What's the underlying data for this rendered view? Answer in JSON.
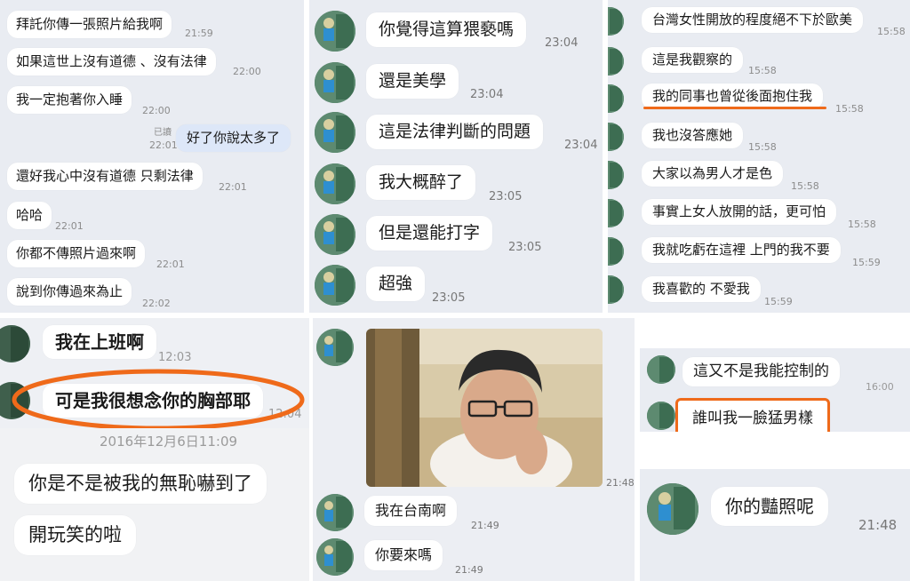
{
  "panel1": {
    "messages": [
      {
        "text": "拜託你傳一張照片給我啊",
        "time": "21:59"
      },
      {
        "text": "如果這世上沒有道德 、沒有法律",
        "time": "22:00"
      },
      {
        "text": "我一定抱著你入睡",
        "time": "22:00"
      },
      {
        "text": "好了你說太多了",
        "time": "22:01",
        "read": "已讀"
      },
      {
        "text": "還好我心中沒有道德 只剩法律",
        "time": "22:01"
      },
      {
        "text": "哈哈",
        "time": "22:01"
      },
      {
        "text": "你都不傳照片過來啊",
        "time": "22:01"
      },
      {
        "text": "說到你傳過來為止",
        "time": "22:02"
      }
    ]
  },
  "panel2": {
    "messages": [
      {
        "text": "你覺得這算猥褻嗎",
        "time": "23:04"
      },
      {
        "text": "還是美學",
        "time": "23:04"
      },
      {
        "text": "這是法律判斷的問題",
        "time": "23:04"
      },
      {
        "text": "我大概醉了",
        "time": "23:05"
      },
      {
        "text": "但是還能打字",
        "time": "23:05"
      },
      {
        "text": "超強",
        "time": "23:05"
      }
    ]
  },
  "panel3": {
    "messages": [
      {
        "text": "台灣女性開放的程度絕不下於歐美",
        "time": "15:58"
      },
      {
        "text": "這是我觀察的",
        "time": "15:58"
      },
      {
        "text": "我的同事也曾從後面抱住我",
        "time": "15:58"
      },
      {
        "text": "我也沒答應她",
        "time": "15:58"
      },
      {
        "text": "大家以為男人才是色",
        "time": "15:58"
      },
      {
        "text": "事實上女人放開的話，更可怕",
        "time": "15:58"
      },
      {
        "text": "我就吃虧在這裡 上門的我不要",
        "time": "15:59"
      },
      {
        "text": "我喜歡的 不愛我",
        "time": "15:59"
      }
    ]
  },
  "panel4": {
    "messages": [
      {
        "text": "我在上班啊",
        "time": "12:03"
      },
      {
        "text": "可是我很想念你的胸部耶",
        "time": "12:04"
      }
    ],
    "date": "2016年12月6日11:09",
    "replies": [
      {
        "text": "你是不是被我的無恥嚇到了"
      },
      {
        "text": "開玩笑的啦"
      }
    ]
  },
  "panel5": {
    "photo_time": "21:48",
    "messages": [
      {
        "text": "我在台南啊",
        "time": "21:49"
      },
      {
        "text": "你要來嗎",
        "time": "21:49"
      }
    ]
  },
  "panel6": {
    "messages": [
      {
        "text": "這又不是我能控制的",
        "time": "16:00"
      },
      {
        "text": "誰叫我一臉猛男樣"
      }
    ]
  },
  "panel7": {
    "messages": [
      {
        "text": "你的豔照呢",
        "time": "21:48"
      }
    ]
  },
  "colors": {
    "panel_bg": "#e9ecf2",
    "bubble": "#ffffff",
    "my_bubble": "#dde7f8",
    "highlight": "#ef6a1a"
  }
}
